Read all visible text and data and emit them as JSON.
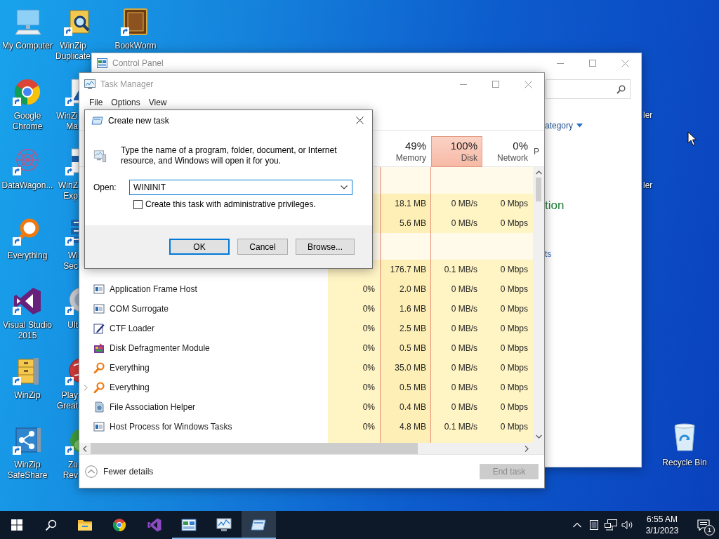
{
  "desktop": {
    "columns": [
      [
        {
          "kind": "computer",
          "shortcut": false,
          "lines": [
            "My Computer"
          ]
        },
        {
          "kind": "chrome",
          "shortcut": true,
          "lines": [
            "Google",
            "Chrome"
          ]
        },
        {
          "kind": "datawagon",
          "shortcut": true,
          "lines": [
            "DataWagon..."
          ]
        },
        {
          "kind": "everything",
          "shortcut": true,
          "lines": [
            "Everything"
          ]
        },
        {
          "kind": "vs",
          "shortcut": true,
          "lines": [
            "Visual Studio",
            "2015"
          ]
        },
        {
          "kind": "winzip",
          "shortcut": true,
          "lines": [
            "WinZip"
          ]
        },
        {
          "kind": "safeshare",
          "shortcut": true,
          "lines": [
            "WinZip",
            "SafeShare"
          ]
        }
      ],
      [
        {
          "kind": "duplicate",
          "shortcut": true,
          "lines": [
            "WinZip",
            "Duplicate"
          ]
        },
        {
          "kind": "image",
          "shortcut": true,
          "lines": [
            "WinZi",
            "Ma"
          ]
        },
        {
          "kind": "pdf",
          "shortcut": true,
          "lines": [
            "WinZ",
            "Exp"
          ]
        },
        {
          "kind": "server",
          "shortcut": true,
          "lines": [
            "Wi",
            "Sec"
          ]
        },
        {
          "kind": "disc",
          "shortcut": true,
          "lines": [
            "Ult"
          ]
        },
        {
          "kind": "ball",
          "shortcut": true,
          "lines": [
            "Play",
            "Great"
          ]
        },
        {
          "kind": "frog",
          "shortcut": true,
          "lines": [
            "Zu",
            "Rev"
          ]
        }
      ],
      [
        {
          "kind": "book",
          "shortcut": true,
          "lines": [
            "BookWorm"
          ]
        }
      ]
    ],
    "cut_labels": [
      "ler",
      "ler"
    ],
    "recycle_bin": {
      "label": "Recycle Bin"
    }
  },
  "control_panel": {
    "title": "Control Panel",
    "view_link": "ategory",
    "section_heading": "tion",
    "section_link": "ts"
  },
  "task_manager": {
    "title": "Task Manager",
    "menu": [
      "File",
      "Options",
      "View"
    ],
    "columns": [
      {
        "percent": "49%",
        "label": "Memory",
        "alert": false
      },
      {
        "percent": "100%",
        "label": "Disk",
        "alert": true
      },
      {
        "percent": "0%",
        "label": "Network",
        "alert": false
      },
      {
        "label": "P",
        "alert": false
      }
    ],
    "rows": [
      {
        "kind": "group"
      },
      {
        "kind": "values",
        "memory": "18.1 MB",
        "disk": "0 MB/s",
        "network": "0 Mbps"
      },
      {
        "kind": "values",
        "memory": "5.6 MB",
        "disk": "0 MB/s",
        "network": "0 Mbps"
      },
      {
        "kind": "group"
      },
      {
        "kind": "values",
        "memory": "176.7 MB",
        "disk": "0.1 MB/s",
        "network": "0 Mbps"
      },
      {
        "kind": "window",
        "name": "Application Frame Host",
        "expandable": false,
        "cpu": "0%",
        "memory": "2.0 MB",
        "disk": "0 MB/s",
        "network": "0 Mbps"
      },
      {
        "kind": "window",
        "name": "COM Surrogate",
        "expandable": false,
        "cpu": "0%",
        "memory": "1.6 MB",
        "disk": "0 MB/s",
        "network": "0 Mbps"
      },
      {
        "kind": "pen",
        "name": "CTF Loader",
        "expandable": false,
        "cpu": "0%",
        "memory": "2.5 MB",
        "disk": "0 MB/s",
        "network": "0 Mbps"
      },
      {
        "kind": "defrag",
        "name": "Disk Defragmenter Module",
        "expandable": false,
        "cpu": "0%",
        "memory": "0.5 MB",
        "disk": "0 MB/s",
        "network": "0 Mbps"
      },
      {
        "kind": "everything",
        "name": "Everything",
        "expandable": false,
        "cpu": "0%",
        "memory": "35.0 MB",
        "disk": "0 MB/s",
        "network": "0 Mbps"
      },
      {
        "kind": "everything",
        "name": "Everything",
        "expandable": true,
        "cpu": "0%",
        "memory": "0.5 MB",
        "disk": "0 MB/s",
        "network": "0 Mbps"
      },
      {
        "kind": "file",
        "name": "File Association Helper",
        "expandable": false,
        "cpu": "0%",
        "memory": "0.4 MB",
        "disk": "0 MB/s",
        "network": "0 Mbps"
      },
      {
        "kind": "window",
        "name": "Host Process for Windows Tasks",
        "expandable": false,
        "cpu": "0%",
        "memory": "4.8 MB",
        "disk": "0.1 MB/s",
        "network": "0 Mbps"
      }
    ],
    "footer": {
      "toggle": "Fewer details",
      "end_task": {
        "label": "End task",
        "disabled": true
      }
    }
  },
  "run_dialog": {
    "title": "Create new task",
    "description": "Type the name of a program, folder, document, or Internet resource, and Windows will open it for you.",
    "open_label": "Open:",
    "value": "WININIT",
    "admin_checkbox": {
      "label": "Create this task with administrative privileges.",
      "checked": false
    },
    "buttons": [
      {
        "label": "OK",
        "default": true
      },
      {
        "label": "Cancel",
        "default": false
      },
      {
        "label": "Browse...",
        "default": false
      }
    ]
  },
  "taskbar": {
    "apps": [
      {
        "kind": "explorer",
        "running": false,
        "selected": false
      },
      {
        "kind": "chrome",
        "running": false,
        "selected": false
      },
      {
        "kind": "vs",
        "running": false,
        "selected": false
      },
      {
        "kind": "control",
        "running": true,
        "selected": false
      },
      {
        "kind": "taskmgr",
        "running": true,
        "selected": false
      },
      {
        "kind": "run",
        "running": true,
        "selected": true
      }
    ],
    "time": "6:55 AM",
    "date": "3/1/2023",
    "notifications": "1"
  }
}
